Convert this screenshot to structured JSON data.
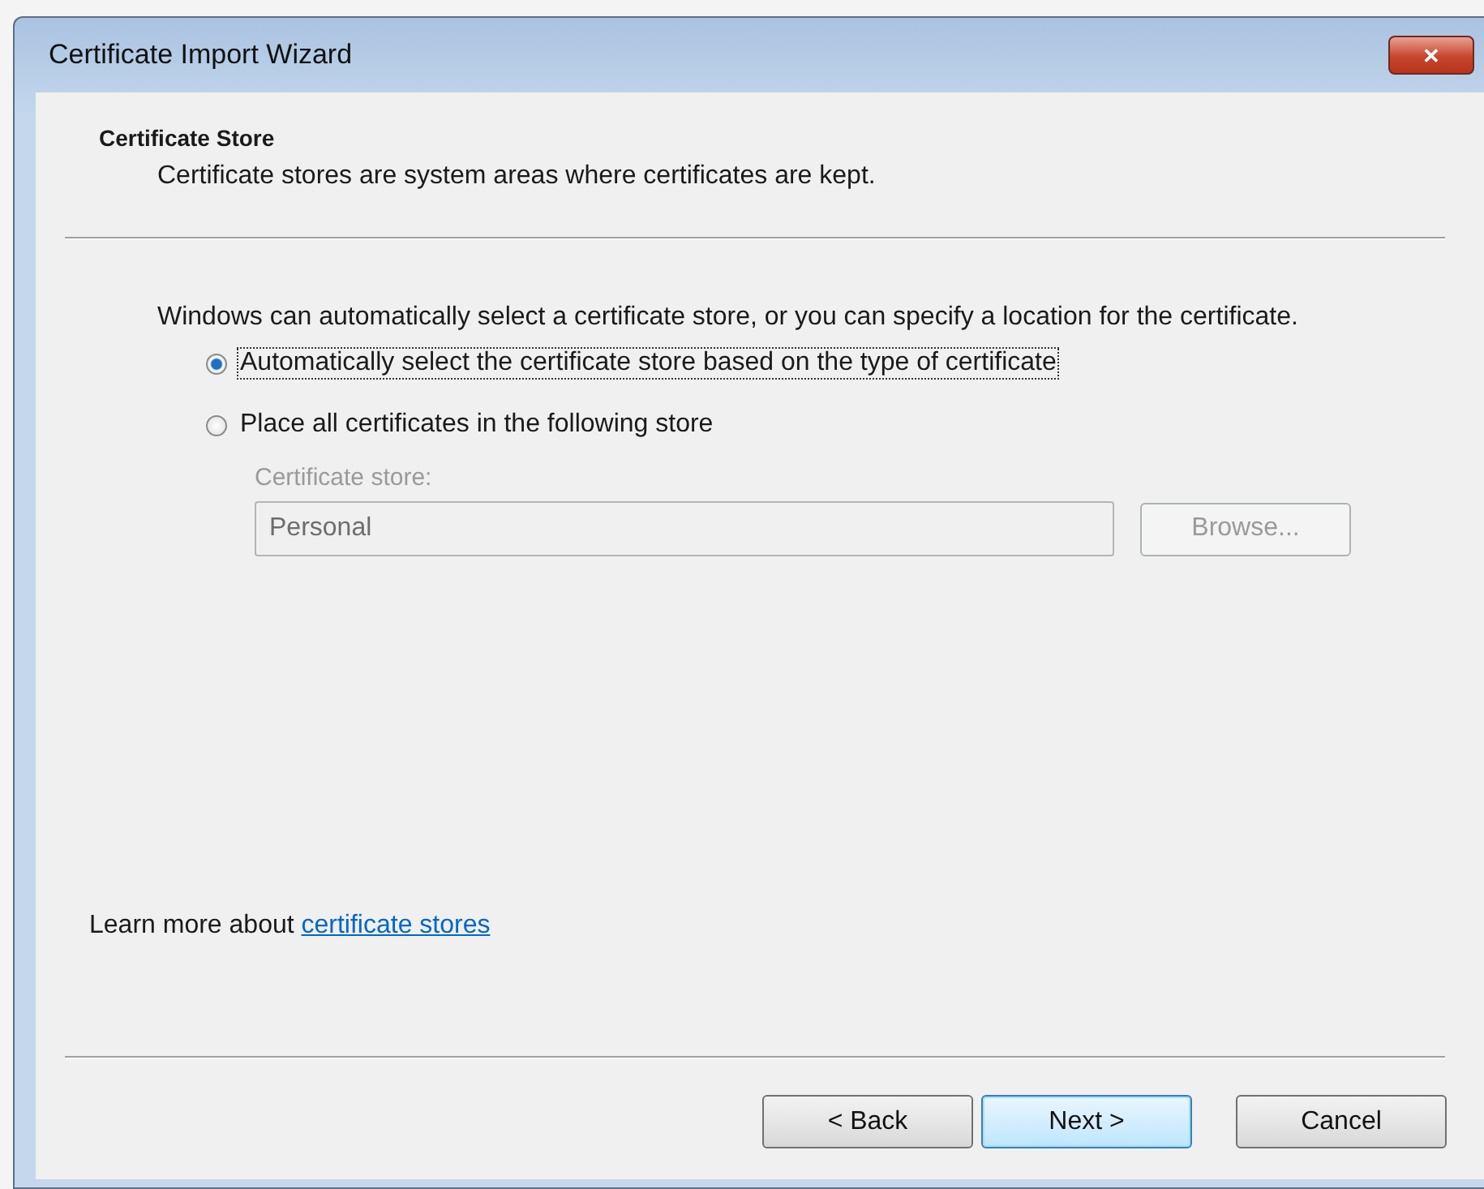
{
  "window": {
    "title": "Certificate Import Wizard",
    "close": "✕"
  },
  "header": {
    "title": "Certificate Store",
    "subtitle": "Certificate stores are system areas where certificates are kept."
  },
  "intro": "Windows can automatically select a certificate store, or you can specify a location for the certificate.",
  "options": [
    {
      "label": "Automatically select the certificate store based on the type of certificate",
      "selected": true
    },
    {
      "label": "Place all certificates in the following store",
      "selected": false
    }
  ],
  "store": {
    "label": "Certificate store:",
    "value": "Personal",
    "disabled": true,
    "browse": "Browse..."
  },
  "learn_more": {
    "text": "Learn more about ",
    "link": "certificate stores"
  },
  "buttons": [
    {
      "label": "< Back",
      "kind": "normal"
    },
    {
      "label": "Next >",
      "kind": "default"
    },
    {
      "label": "Cancel",
      "kind": "normal"
    }
  ]
}
